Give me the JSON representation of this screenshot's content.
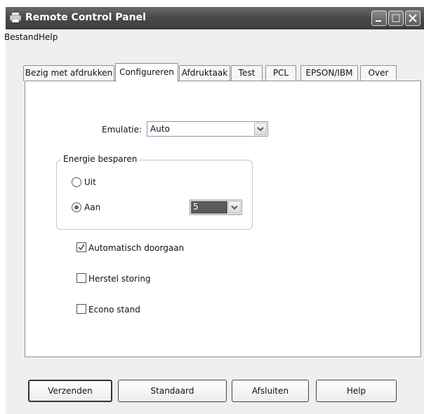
{
  "window": {
    "title": "Remote Control Panel"
  },
  "menu": [
    "Bestand",
    "Help"
  ],
  "tabs": [
    {
      "label": "Bezig met afdrukken",
      "active": false
    },
    {
      "label": "Configureren",
      "active": true
    },
    {
      "label": "Afdruktaak",
      "active": false
    },
    {
      "label": "Test",
      "active": false
    },
    {
      "label": "PCL",
      "active": false
    },
    {
      "label": "EPSON/IBM",
      "active": false
    },
    {
      "label": "Over",
      "active": false
    }
  ],
  "emulation": {
    "label": "Emulatie:",
    "value": "Auto"
  },
  "power_saving": {
    "title": "Energie besparen",
    "off_label": "Uit",
    "on_label": "Aan",
    "selected": "Aan",
    "minutes": "5"
  },
  "options": [
    {
      "label": "Automatisch doorgaan",
      "checked": true
    },
    {
      "label": "Herstel storing",
      "checked": false
    },
    {
      "label": "Econo stand",
      "checked": false
    }
  ],
  "buttons": {
    "send": "Verzenden",
    "default": "Standaard",
    "close": "Afsluiten",
    "help": "Help"
  },
  "colors": {
    "titlebar": "#4a4a4a",
    "window_bg": "#efefef",
    "panel_bg": "#ffffff",
    "selected_value_bg": "#5a5a5a"
  },
  "icons": {
    "app": "printer-icon",
    "minimize": "minimize-icon",
    "maximize": "maximize-icon",
    "close": "close-icon",
    "dropdown": "chevron-down-icon",
    "check": "checkmark-icon"
  }
}
